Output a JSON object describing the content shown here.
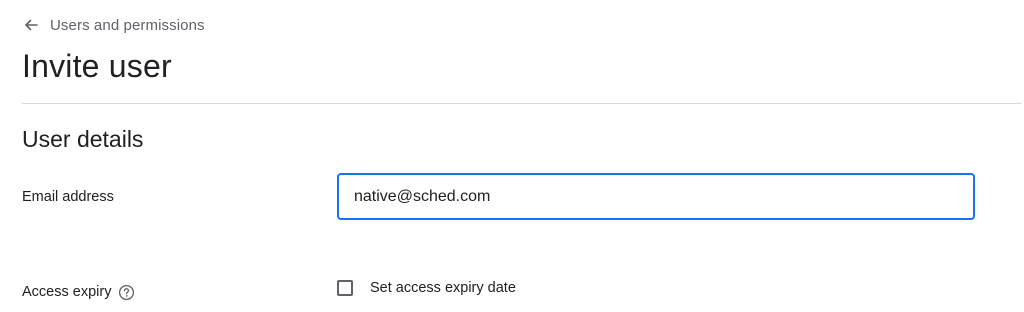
{
  "breadcrumb": {
    "icon": "arrow-back-icon",
    "label": "Users and permissions"
  },
  "page": {
    "title": "Invite user"
  },
  "section": {
    "title": "User details"
  },
  "email": {
    "label": "Email address",
    "value": "native@sched.com"
  },
  "access_expiry": {
    "label": "Access expiry",
    "help_icon": "help-circle-icon",
    "checkbox_label": "Set access expiry date",
    "checked": false
  },
  "colors": {
    "accent": "#1a73e8",
    "muted_text": "#5f6368",
    "divider": "#dadce0"
  }
}
